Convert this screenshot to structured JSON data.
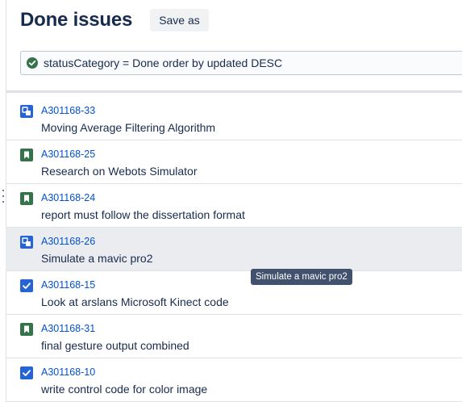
{
  "header": {
    "title": "Done issues",
    "save_as_label": "Save as"
  },
  "search": {
    "status_icon": "check-circle-icon",
    "query": "statusCategory = Done order by updated DESC"
  },
  "issues": [
    {
      "key": "A301168-33",
      "summary": "Moving Average Filtering Algorithm",
      "type_icon": "subtask-icon",
      "type_color": "#2563d6"
    },
    {
      "key": "A301168-25",
      "summary": "Research on Webots Simulator",
      "type_icon": "story-icon",
      "type_color": "#36734a"
    },
    {
      "key": "A301168-24",
      "summary": "report must follow the dissertation format",
      "type_icon": "story-icon",
      "type_color": "#36734a"
    },
    {
      "key": "A301168-26",
      "summary": "Simulate a mavic pro2",
      "type_icon": "subtask-icon",
      "type_color": "#2563d6",
      "selected": true
    },
    {
      "key": "A301168-15",
      "summary": "Look at arslans Microsoft Kinect code",
      "type_icon": "task-icon",
      "type_color": "#2563d6"
    },
    {
      "key": "A301168-31",
      "summary": "final gesture output combined",
      "type_icon": "story-icon",
      "type_color": "#36734a"
    },
    {
      "key": "A301168-10",
      "summary": "write control code for color image",
      "type_icon": "task-icon",
      "type_color": "#2563d6"
    }
  ],
  "tooltip": {
    "text": "Simulate a mavic pro2"
  },
  "colors": {
    "link": "#0052cc",
    "text": "#172b4d",
    "selected_row": "#ebecf0",
    "success": "#36734a"
  }
}
